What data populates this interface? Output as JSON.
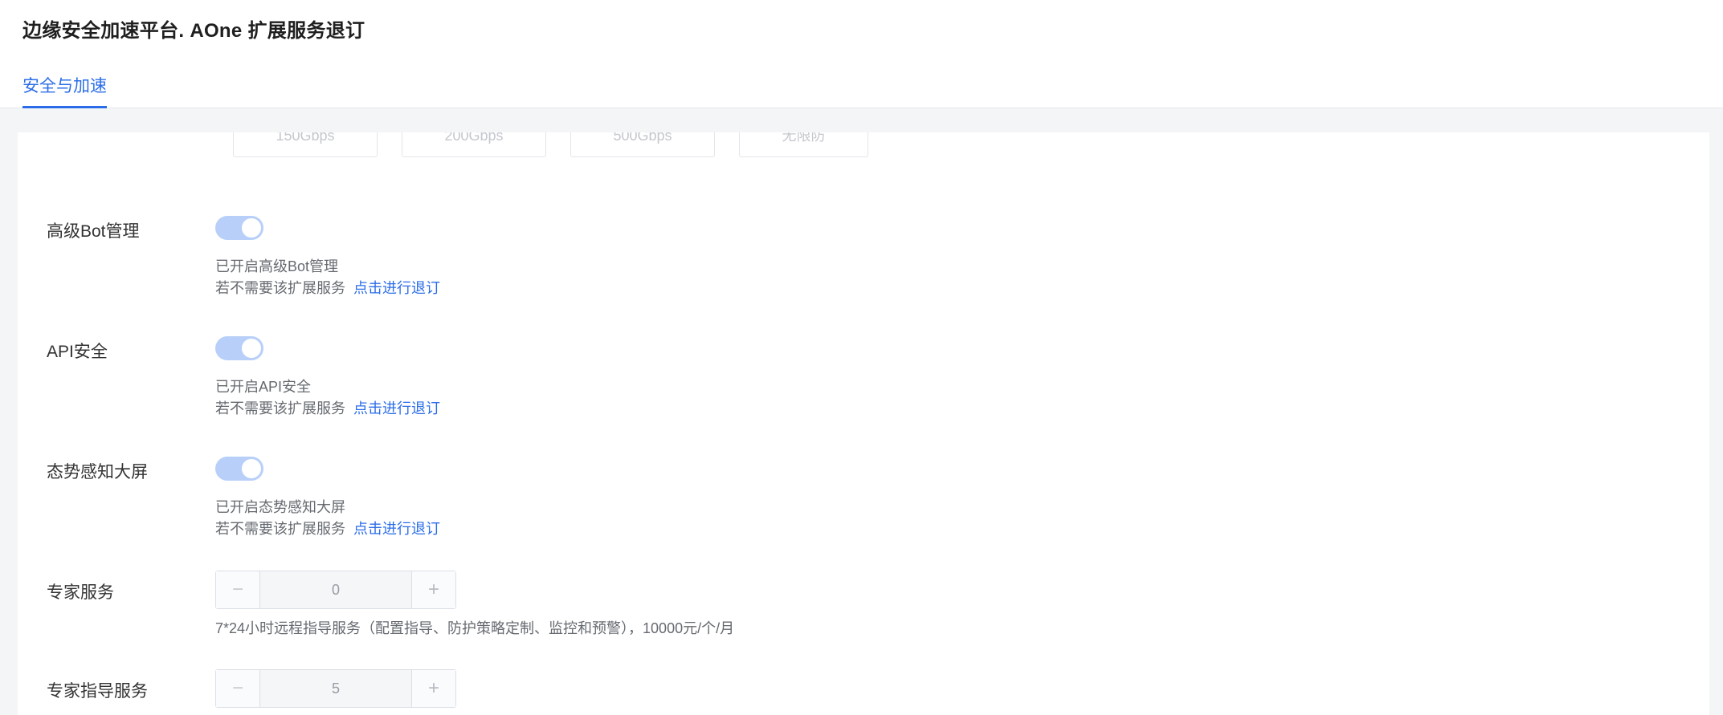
{
  "header": {
    "title": "边缘安全加速平台. AOne 扩展服务退订",
    "tab_label": "安全与加速"
  },
  "bandwidth_options": [
    "150Gbps",
    "200Gbps",
    "500Gbps",
    "无限防"
  ],
  "services": [
    {
      "label": "高级Bot管理",
      "enabled": true,
      "status": "已开启高级Bot管理",
      "prompt": "若不需要该扩展服务",
      "link": "点击进行退订"
    },
    {
      "label": "API安全",
      "enabled": true,
      "status": "已开启API安全",
      "prompt": "若不需要该扩展服务",
      "link": "点击进行退订"
    },
    {
      "label": "态势感知大屏",
      "enabled": true,
      "status": "已开启态势感知大屏",
      "prompt": "若不需要该扩展服务",
      "link": "点击进行退订"
    }
  ],
  "expert_service": {
    "label": "专家服务",
    "value": "0",
    "minus": "−",
    "plus": "+",
    "description": "7*24小时远程指导服务（配置指导、防护策略定制、监控和预警），10000元/个/月"
  },
  "expert_guidance": {
    "label": "专家指导服务",
    "value": "5",
    "minus": "−",
    "plus": "+"
  },
  "colors": {
    "accent": "#2b6de8",
    "toggle_on_disabled": "#b8d0f9"
  }
}
